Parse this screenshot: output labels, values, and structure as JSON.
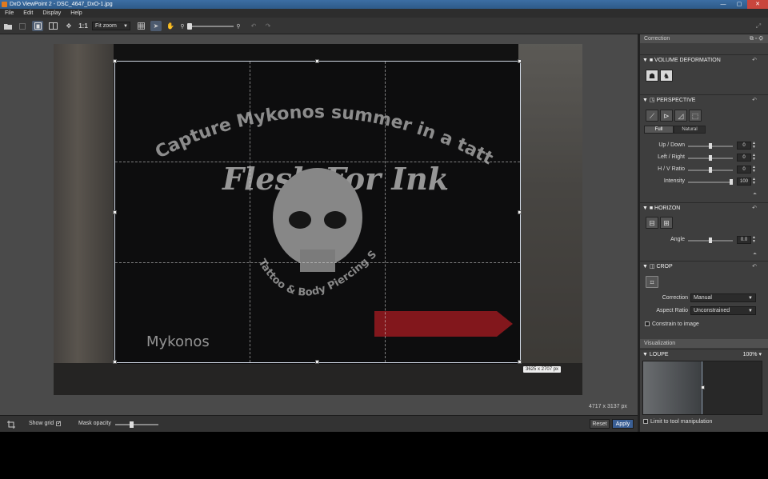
{
  "titlebar": {
    "title": "DxO ViewPoint 2 - DSC_4647_DxO-1.jpg",
    "min": "—",
    "max": "▢",
    "close": "✕"
  },
  "menu": [
    "File",
    "Edit",
    "Display",
    "Help"
  ],
  "toolbar": {
    "one_to_one": "1:1",
    "zoom": "Fit zoom"
  },
  "viewer": {
    "photo_text": {
      "headline": "Capture Mykonos summer in a tattoo",
      "brand": "Flesh For Ink",
      "arc": "Tattoo & Body Piercing Studio",
      "town": "Mykonos"
    },
    "crop_size": "3625 x 2707 px",
    "image_size": "4717 x 3137 px"
  },
  "bottombar": {
    "show_grid": "Show grid",
    "mask_opacity": "Mask opacity",
    "reset": "Reset",
    "apply": "Apply"
  },
  "panel": {
    "header": "Correction",
    "volume": {
      "title": "VOLUME DEFORMATION"
    },
    "perspective": {
      "title": "PERSPECTIVE",
      "modes": [
        "Full",
        "Natural"
      ],
      "sliders": [
        {
          "label": "Up / Down",
          "value": "0"
        },
        {
          "label": "Left / Right",
          "value": "0"
        },
        {
          "label": "H / V Ratio",
          "value": "0"
        },
        {
          "label": "Intensity",
          "value": "100"
        }
      ]
    },
    "horizon": {
      "title": "HORIZON",
      "angle_label": "Angle",
      "angle_value": "0.0"
    },
    "crop": {
      "title": "CROP",
      "correction_label": "Correction",
      "correction_value": "Manual",
      "aspect_label": "Aspect Ratio",
      "aspect_value": "Unconstrained",
      "constrain": "Constrain to image"
    },
    "visualization": {
      "header": "Visualization",
      "loupe": "LOUPE",
      "loupe_zoom": "100%",
      "limit": "Limit to tool manipulation"
    }
  }
}
